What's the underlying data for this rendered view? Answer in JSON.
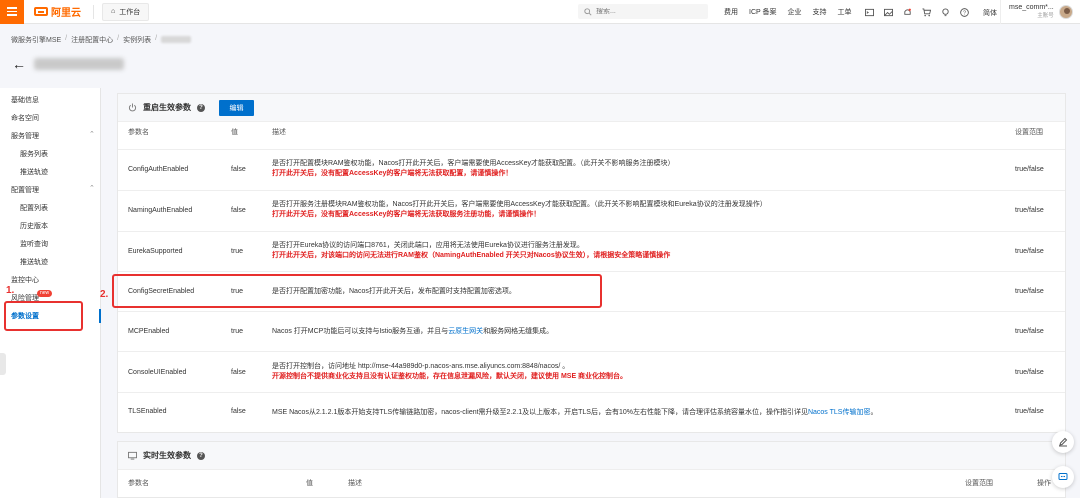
{
  "topbar": {
    "brand": "阿里云",
    "workbench": "工作台",
    "search_placeholder": "搜索...",
    "links": [
      "费用",
      "ICP 备案",
      "企业",
      "支持",
      "工单"
    ],
    "lang": "简体",
    "user_name": "mse_comm*...",
    "user_role": "主账号"
  },
  "breadcrumb": [
    "微服务引擎MSE",
    "注册配置中心",
    "实例列表"
  ],
  "sidebar": {
    "items": [
      {
        "label": "基础信息"
      },
      {
        "label": "命名空间"
      },
      {
        "label": "服务管理"
      },
      {
        "label": "服务列表"
      },
      {
        "label": "推送轨迹"
      },
      {
        "label": "配置管理"
      },
      {
        "label": "配置列表"
      },
      {
        "label": "历史版本"
      },
      {
        "label": "监听查询"
      },
      {
        "label": "推送轨迹"
      },
      {
        "label": "监控中心"
      },
      {
        "label": "风险管理"
      },
      {
        "label": "参数设置"
      }
    ],
    "new_badge": "new"
  },
  "restart_card": {
    "title": "重启生效参数",
    "edit_label": "编辑",
    "columns": [
      "参数名",
      "值",
      "描述",
      "设置范围"
    ],
    "rows": [
      {
        "name": "ConfigAuthEnabled",
        "value": "false",
        "desc": "是否打开配置模块RAM鉴权功能，Nacos打开此开关后，客户端需要使用AccessKey才能获取配置。（此开关不影响服务注册模块）",
        "warn": "打开此开关后，没有配置AccessKey的客户端将无法获取配置，请谨慎操作！",
        "range": "true/false"
      },
      {
        "name": "NamingAuthEnabled",
        "value": "false",
        "desc": "是否打开服务注册模块RAM鉴权功能，Nacos打开此开关后，客户端需要使用AccessKey才能获取配置。（此开关不影响配置模块和Eureka协议的注册发现操作）",
        "warn": "打开此开关后，没有配置AccessKey的客户端将无法获取服务注册功能，请谨慎操作！",
        "range": "true/false"
      },
      {
        "name": "EurekaSupported",
        "value": "true",
        "desc": "是否打开Eureka协议的访问端口8761，关闭此端口，应用将无法使用Eureka协议进行服务注册发现。",
        "warn": "打开此开关后，对该端口的访问无法进行RAM鉴权（NamingAuthEnabled 开关只对Nacos协议生效），请根据安全策略谨慎操作",
        "range": "true/false"
      },
      {
        "name": "ConfigSecretEnabled",
        "value": "true",
        "desc": "是否打开配置加密功能，Nacos打开此开关后，发布配置时支持配置加密选项。",
        "warn": "",
        "range": "true/false"
      },
      {
        "name": "MCPEnabled",
        "value": "true",
        "desc_before": "Nacos 打开MCP功能后可以支持与Istio服务互通，并且与",
        "desc_link": "云原生网关",
        "desc_after": "和服务网格无缝集成。",
        "range": "true/false"
      },
      {
        "name": "ConsoleUIEnabled",
        "value": "false",
        "desc": "是否打开控制台，访问地址 http://mse-44a989d0-p.nacos-ans.mse.aliyuncs.com:8848/nacos/ 。",
        "warn": "开源控制台不提供商业化支持且没有认证鉴权功能，存在信息泄漏风险，默认关闭，建议使用 MSE 商业化控制台。",
        "range": "true/false"
      },
      {
        "name": "TLSEnabled",
        "value": "false",
        "desc_before": "MSE Nacos从2.1.2.1版本开始支持TLS传输链路加密，nacos-client需升级至2.2.1及以上版本，开启TLS后，会有10%左右性能下降，请合理评估系统容量水位，操作指引详见",
        "desc_link": "Nacos TLS传输加密",
        "desc_after": "。",
        "range": "true/false"
      }
    ]
  },
  "realtime_card": {
    "title": "实时生效参数",
    "columns": [
      "参数名",
      "值",
      "描述",
      "设置范围",
      "操作"
    ]
  },
  "annotations": [
    "1.",
    "2."
  ],
  "colors": {
    "brand": "#ff6a00",
    "primary": "#0070cc",
    "warn": "#e02020",
    "highlight": "#e8312f"
  }
}
